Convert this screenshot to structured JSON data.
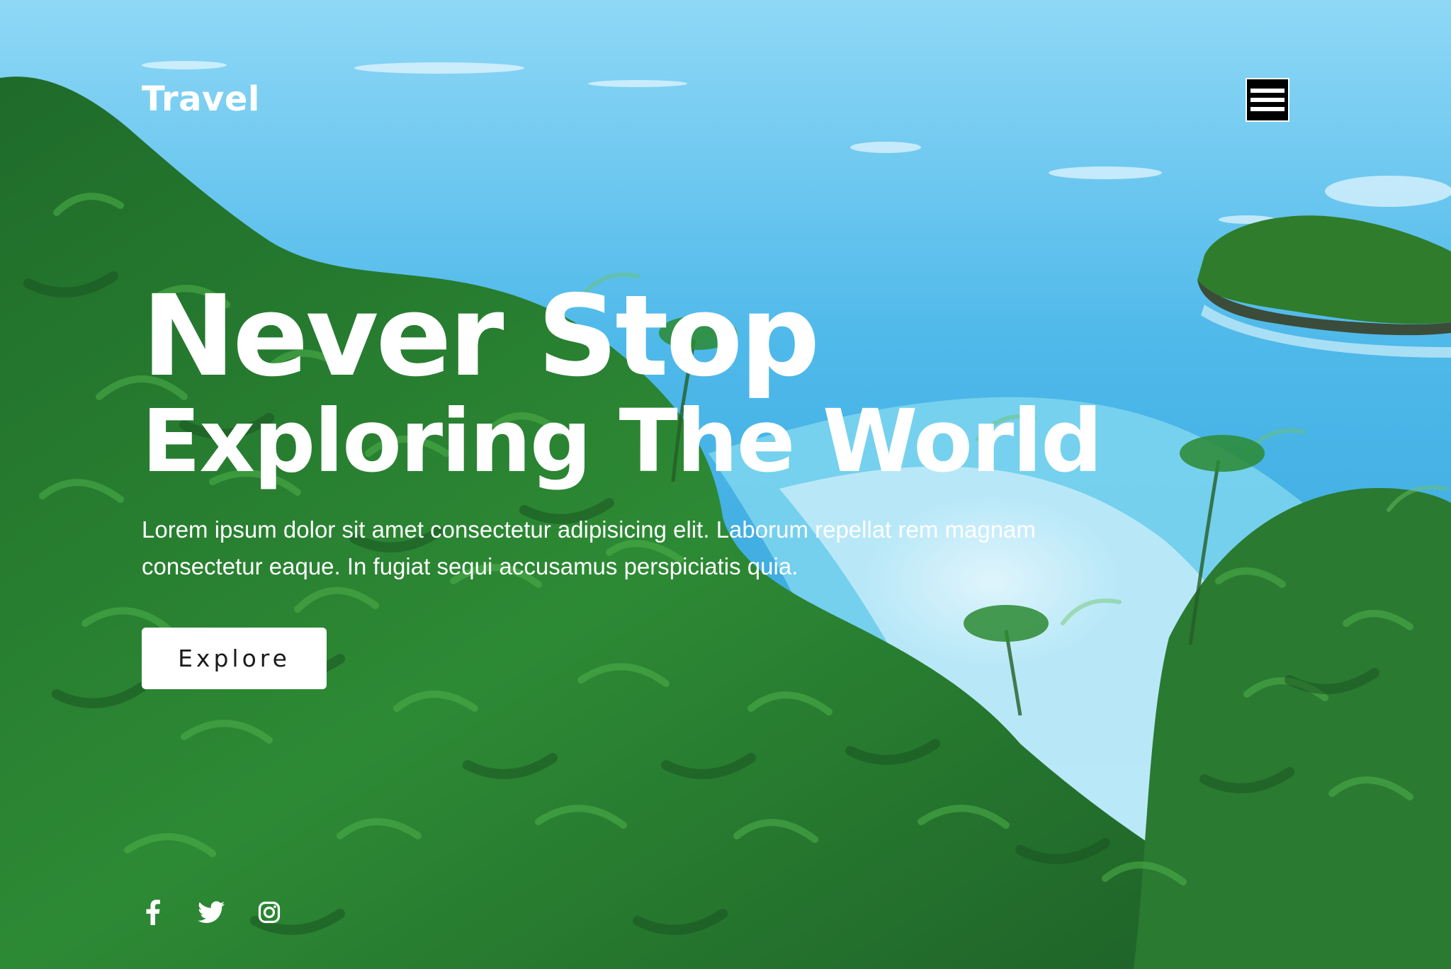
{
  "header": {
    "brand": "Travel",
    "menu_icon": "hamburger-menu-icon"
  },
  "hero": {
    "headline_line1": "Never Stop",
    "headline_line2": "Exploring The World",
    "description": "Lorem ipsum dolor sit amet consectetur adipisicing elit. Laborum repellat rem magnam consectetur eaque. In fugiat sequi accusamus perspiciatis quia.",
    "cta_label": "Explore"
  },
  "social": [
    {
      "icon": "facebook-icon"
    },
    {
      "icon": "twitter-icon"
    },
    {
      "icon": "instagram-icon"
    }
  ],
  "colors": {
    "text": "#ffffff",
    "button_bg": "#ffffff",
    "button_text": "#1a1a1a",
    "menu_bg": "#000000",
    "ocean": "#5cc4ee",
    "foliage": "#2f8a3a"
  }
}
